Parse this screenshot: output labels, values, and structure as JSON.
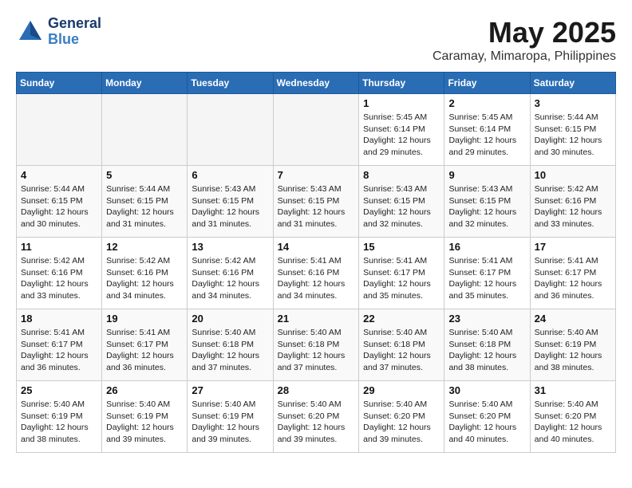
{
  "header": {
    "logo_line1": "General",
    "logo_line2": "Blue",
    "month": "May 2025",
    "location": "Caramay, Mimaropa, Philippines"
  },
  "weekdays": [
    "Sunday",
    "Monday",
    "Tuesday",
    "Wednesday",
    "Thursday",
    "Friday",
    "Saturday"
  ],
  "weeks": [
    [
      {
        "day": "",
        "info": ""
      },
      {
        "day": "",
        "info": ""
      },
      {
        "day": "",
        "info": ""
      },
      {
        "day": "",
        "info": ""
      },
      {
        "day": "1",
        "info": "Sunrise: 5:45 AM\nSunset: 6:14 PM\nDaylight: 12 hours\nand 29 minutes."
      },
      {
        "day": "2",
        "info": "Sunrise: 5:45 AM\nSunset: 6:14 PM\nDaylight: 12 hours\nand 29 minutes."
      },
      {
        "day": "3",
        "info": "Sunrise: 5:44 AM\nSunset: 6:15 PM\nDaylight: 12 hours\nand 30 minutes."
      }
    ],
    [
      {
        "day": "4",
        "info": "Sunrise: 5:44 AM\nSunset: 6:15 PM\nDaylight: 12 hours\nand 30 minutes."
      },
      {
        "day": "5",
        "info": "Sunrise: 5:44 AM\nSunset: 6:15 PM\nDaylight: 12 hours\nand 31 minutes."
      },
      {
        "day": "6",
        "info": "Sunrise: 5:43 AM\nSunset: 6:15 PM\nDaylight: 12 hours\nand 31 minutes."
      },
      {
        "day": "7",
        "info": "Sunrise: 5:43 AM\nSunset: 6:15 PM\nDaylight: 12 hours\nand 31 minutes."
      },
      {
        "day": "8",
        "info": "Sunrise: 5:43 AM\nSunset: 6:15 PM\nDaylight: 12 hours\nand 32 minutes."
      },
      {
        "day": "9",
        "info": "Sunrise: 5:43 AM\nSunset: 6:15 PM\nDaylight: 12 hours\nand 32 minutes."
      },
      {
        "day": "10",
        "info": "Sunrise: 5:42 AM\nSunset: 6:16 PM\nDaylight: 12 hours\nand 33 minutes."
      }
    ],
    [
      {
        "day": "11",
        "info": "Sunrise: 5:42 AM\nSunset: 6:16 PM\nDaylight: 12 hours\nand 33 minutes."
      },
      {
        "day": "12",
        "info": "Sunrise: 5:42 AM\nSunset: 6:16 PM\nDaylight: 12 hours\nand 34 minutes."
      },
      {
        "day": "13",
        "info": "Sunrise: 5:42 AM\nSunset: 6:16 PM\nDaylight: 12 hours\nand 34 minutes."
      },
      {
        "day": "14",
        "info": "Sunrise: 5:41 AM\nSunset: 6:16 PM\nDaylight: 12 hours\nand 34 minutes."
      },
      {
        "day": "15",
        "info": "Sunrise: 5:41 AM\nSunset: 6:17 PM\nDaylight: 12 hours\nand 35 minutes."
      },
      {
        "day": "16",
        "info": "Sunrise: 5:41 AM\nSunset: 6:17 PM\nDaylight: 12 hours\nand 35 minutes."
      },
      {
        "day": "17",
        "info": "Sunrise: 5:41 AM\nSunset: 6:17 PM\nDaylight: 12 hours\nand 36 minutes."
      }
    ],
    [
      {
        "day": "18",
        "info": "Sunrise: 5:41 AM\nSunset: 6:17 PM\nDaylight: 12 hours\nand 36 minutes."
      },
      {
        "day": "19",
        "info": "Sunrise: 5:41 AM\nSunset: 6:17 PM\nDaylight: 12 hours\nand 36 minutes."
      },
      {
        "day": "20",
        "info": "Sunrise: 5:40 AM\nSunset: 6:18 PM\nDaylight: 12 hours\nand 37 minutes."
      },
      {
        "day": "21",
        "info": "Sunrise: 5:40 AM\nSunset: 6:18 PM\nDaylight: 12 hours\nand 37 minutes."
      },
      {
        "day": "22",
        "info": "Sunrise: 5:40 AM\nSunset: 6:18 PM\nDaylight: 12 hours\nand 37 minutes."
      },
      {
        "day": "23",
        "info": "Sunrise: 5:40 AM\nSunset: 6:18 PM\nDaylight: 12 hours\nand 38 minutes."
      },
      {
        "day": "24",
        "info": "Sunrise: 5:40 AM\nSunset: 6:19 PM\nDaylight: 12 hours\nand 38 minutes."
      }
    ],
    [
      {
        "day": "25",
        "info": "Sunrise: 5:40 AM\nSunset: 6:19 PM\nDaylight: 12 hours\nand 38 minutes."
      },
      {
        "day": "26",
        "info": "Sunrise: 5:40 AM\nSunset: 6:19 PM\nDaylight: 12 hours\nand 39 minutes."
      },
      {
        "day": "27",
        "info": "Sunrise: 5:40 AM\nSunset: 6:19 PM\nDaylight: 12 hours\nand 39 minutes."
      },
      {
        "day": "28",
        "info": "Sunrise: 5:40 AM\nSunset: 6:20 PM\nDaylight: 12 hours\nand 39 minutes."
      },
      {
        "day": "29",
        "info": "Sunrise: 5:40 AM\nSunset: 6:20 PM\nDaylight: 12 hours\nand 39 minutes."
      },
      {
        "day": "30",
        "info": "Sunrise: 5:40 AM\nSunset: 6:20 PM\nDaylight: 12 hours\nand 40 minutes."
      },
      {
        "day": "31",
        "info": "Sunrise: 5:40 AM\nSunset: 6:20 PM\nDaylight: 12 hours\nand 40 minutes."
      }
    ]
  ]
}
